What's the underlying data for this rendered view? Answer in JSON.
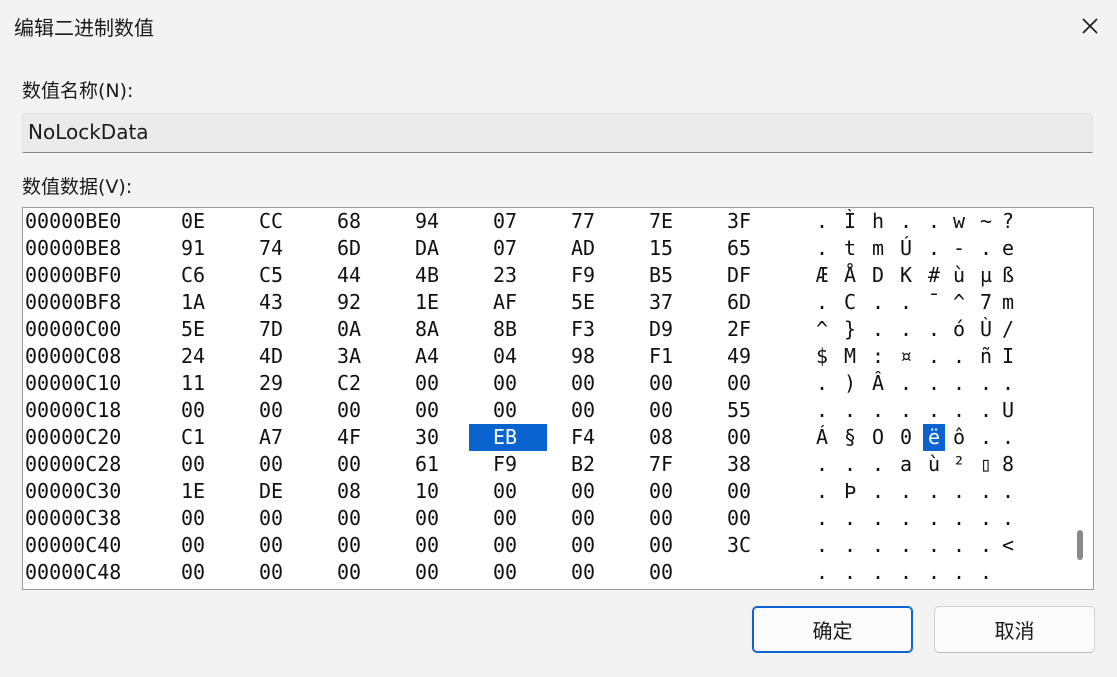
{
  "window": {
    "title": "编辑二进制数值"
  },
  "name_label": "数值名称(N):",
  "name_value": "NoLockData",
  "data_label": "数值数据(V):",
  "buttons": {
    "ok": "确定",
    "cancel": "取消"
  },
  "colors": {
    "accent": "#0a64d0"
  },
  "selected": {
    "row": 8,
    "byte": 4
  },
  "rows": [
    {
      "addr": "00000BE0",
      "bytes": [
        "0E",
        "CC",
        "68",
        "94",
        "07",
        "77",
        "7E",
        "3F"
      ],
      "ascii": [
        ".",
        "Ì",
        "h",
        ".",
        ".",
        "w",
        "~",
        "?"
      ]
    },
    {
      "addr": "00000BE8",
      "bytes": [
        "91",
        "74",
        "6D",
        "DA",
        "07",
        "AD",
        "15",
        "65"
      ],
      "ascii": [
        ".",
        "t",
        "m",
        "Ú",
        ".",
        "-",
        ".",
        "e"
      ]
    },
    {
      "addr": "00000BF0",
      "bytes": [
        "C6",
        "C5",
        "44",
        "4B",
        "23",
        "F9",
        "B5",
        "DF"
      ],
      "ascii": [
        "Æ",
        "Å",
        "D",
        "K",
        "#",
        "ù",
        "µ",
        "ß"
      ]
    },
    {
      "addr": "00000BF8",
      "bytes": [
        "1A",
        "43",
        "92",
        "1E",
        "AF",
        "5E",
        "37",
        "6D"
      ],
      "ascii": [
        ".",
        "C",
        ".",
        ".",
        "¯",
        "^",
        "7",
        "m"
      ]
    },
    {
      "addr": "00000C00",
      "bytes": [
        "5E",
        "7D",
        "0A",
        "8A",
        "8B",
        "F3",
        "D9",
        "2F"
      ],
      "ascii": [
        "^",
        "}",
        ".",
        ".",
        ".",
        "ó",
        "Ù",
        "/"
      ]
    },
    {
      "addr": "00000C08",
      "bytes": [
        "24",
        "4D",
        "3A",
        "A4",
        "04",
        "98",
        "F1",
        "49"
      ],
      "ascii": [
        "$",
        "M",
        ":",
        "¤",
        ".",
        ".",
        "ñ",
        "I"
      ]
    },
    {
      "addr": "00000C10",
      "bytes": [
        "11",
        "29",
        "C2",
        "00",
        "00",
        "00",
        "00",
        "00"
      ],
      "ascii": [
        ".",
        ")",
        "Â",
        ".",
        ".",
        ".",
        ".",
        "."
      ]
    },
    {
      "addr": "00000C18",
      "bytes": [
        "00",
        "00",
        "00",
        "00",
        "00",
        "00",
        "00",
        "55"
      ],
      "ascii": [
        ".",
        ".",
        ".",
        ".",
        ".",
        ".",
        ".",
        "U"
      ]
    },
    {
      "addr": "00000C20",
      "bytes": [
        "C1",
        "A7",
        "4F",
        "30",
        "EB",
        "F4",
        "08",
        "00"
      ],
      "ascii": [
        "Á",
        "§",
        "O",
        "0",
        "ë",
        "ô",
        ".",
        "."
      ]
    },
    {
      "addr": "00000C28",
      "bytes": [
        "00",
        "00",
        "00",
        "61",
        "F9",
        "B2",
        "7F",
        "38"
      ],
      "ascii": [
        ".",
        ".",
        ".",
        "a",
        "ù",
        "²",
        "▯",
        "8"
      ]
    },
    {
      "addr": "00000C30",
      "bytes": [
        "1E",
        "DE",
        "08",
        "10",
        "00",
        "00",
        "00",
        "00"
      ],
      "ascii": [
        ".",
        "Þ",
        ".",
        ".",
        ".",
        ".",
        ".",
        "."
      ]
    },
    {
      "addr": "00000C38",
      "bytes": [
        "00",
        "00",
        "00",
        "00",
        "00",
        "00",
        "00",
        "00"
      ],
      "ascii": [
        ".",
        ".",
        ".",
        ".",
        ".",
        ".",
        ".",
        "."
      ]
    },
    {
      "addr": "00000C40",
      "bytes": [
        "00",
        "00",
        "00",
        "00",
        "00",
        "00",
        "00",
        "3C"
      ],
      "ascii": [
        ".",
        ".",
        ".",
        ".",
        ".",
        ".",
        ".",
        "<"
      ]
    },
    {
      "addr": "00000C48",
      "bytes": [
        "00",
        "00",
        "00",
        "00",
        "00",
        "00",
        "00"
      ],
      "ascii": [
        ".",
        ".",
        ".",
        ".",
        ".",
        ".",
        "."
      ]
    }
  ]
}
